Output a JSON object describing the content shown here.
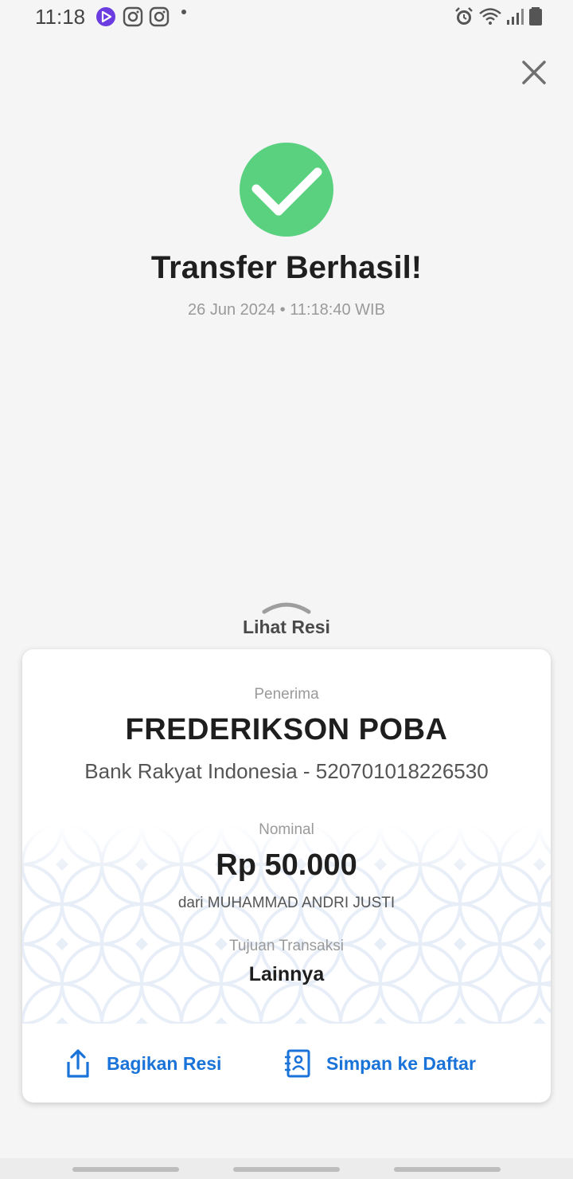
{
  "status_bar": {
    "time": "11:18",
    "left_icons": [
      "media-app-icon",
      "instagram-icon",
      "instagram-icon"
    ],
    "right_icons": [
      "alarm-icon",
      "wifi-icon",
      "signal-icon",
      "battery-icon"
    ]
  },
  "header": {
    "close_icon": "close-icon"
  },
  "success": {
    "icon": "check-icon",
    "title": "Transfer Berhasil!",
    "datetime": "26 Jun 2024 • 11:18:40 WIB",
    "accent_color": "#59d17f"
  },
  "receipt_toggle": {
    "label": "Lihat Resi",
    "icon": "chevron-up-icon"
  },
  "receipt": {
    "recipient_label": "Penerima",
    "recipient_name": "FREDERIKSON POBA",
    "recipient_bank": "Bank Rakyat Indonesia - 520701018226530",
    "amount_label": "Nominal",
    "amount": "Rp 50.000",
    "sender": "dari MUHAMMAD ANDRI JUSTI",
    "purpose_label": "Tujuan Transaksi",
    "purpose": "Lainnya"
  },
  "actions": {
    "share_label": "Bagikan Resi",
    "share_icon": "share-icon",
    "save_label": "Simpan ke Daftar",
    "save_icon": "contact-list-icon",
    "color": "#1a73d9"
  }
}
